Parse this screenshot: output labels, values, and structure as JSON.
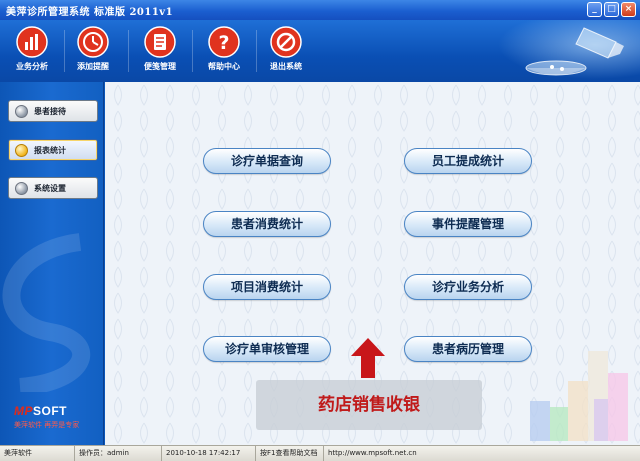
{
  "window": {
    "title": "美萍诊所管理系统 标准版 2011v1",
    "buttons": {
      "minimize": "_",
      "maximize": "□",
      "close": "×"
    }
  },
  "toolbar": {
    "items": [
      {
        "label": "业务分析",
        "icon": "bar-chart-icon"
      },
      {
        "label": "添加提醒",
        "icon": "clock-icon"
      },
      {
        "label": "便笺管理",
        "icon": "notepad-icon"
      },
      {
        "label": "帮助中心",
        "icon": "help-icon"
      },
      {
        "label": "退出系统",
        "icon": "no-entry-icon"
      }
    ]
  },
  "sidebar": {
    "items": [
      {
        "label": "患者接待",
        "active": false
      },
      {
        "label": "报表统计",
        "active": true
      },
      {
        "label": "系统设置",
        "active": false
      }
    ],
    "logo": {
      "brand_prefix": "MP",
      "brand_suffix": "SOFT",
      "slogan": "美萍软件 再弄是专家"
    }
  },
  "main": {
    "buttons": [
      "诊疗单据查询",
      "员工提成统计",
      "患者消费统计",
      "事件提醒管理",
      "项目消费统计",
      "诊疗业务分析",
      "诊疗单审核管理",
      "患者病历管理"
    ],
    "promo": "药店销售收银"
  },
  "statusbar": {
    "app": "美萍软件",
    "operator": "操作员：admin",
    "datetime": "2010-10-18 17:42:17",
    "hint": "按F1查看帮助文档",
    "url": "http://www.mpsoft.net.cn"
  },
  "colors": {
    "accent": "#0a56b8",
    "title_bar": "#1b5fd0",
    "promo_text": "#c01a1a"
  }
}
